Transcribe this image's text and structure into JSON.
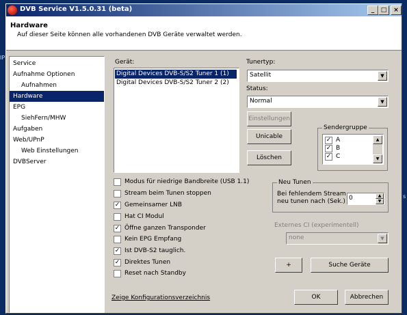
{
  "window": {
    "title": "DVB Service V1.5.0.31 (beta)",
    "controls": {
      "minimize": "_",
      "maximize": "□",
      "close": "×"
    }
  },
  "desktop": {
    "left_glyph": "IP",
    "right_glyph": "s"
  },
  "header": {
    "title": "Hardware",
    "description": "Auf dieser Seite können alle vorhandenen DVB Geräte verwaltet werden."
  },
  "nav": {
    "items": [
      {
        "label": "Service"
      },
      {
        "label": "Aufnahme Optionen"
      },
      {
        "label": "Aufnahmen"
      },
      {
        "label": "Hardware"
      },
      {
        "label": "EPG"
      },
      {
        "label": "SiehFern/MHW"
      },
      {
        "label": "Aufgaben"
      },
      {
        "label": "Web/UPnP"
      },
      {
        "label": "Web Einstellungen"
      },
      {
        "label": "DVBServer"
      }
    ]
  },
  "device": {
    "label": "Gerät:",
    "items": [
      "Digital Devices DVB-S/S2 Tuner 1 (1)",
      "Digital Devices DVB-S/S2 Tuner 2 (2)"
    ]
  },
  "tunertype": {
    "label": "Tunertyp:",
    "value": "Satellit"
  },
  "status": {
    "label": "Status:",
    "value": "Normal"
  },
  "buttons": {
    "settings": "Einstellungen",
    "unicable": "Unicable",
    "delete": "Löschen",
    "plus": "+",
    "search": "Suche Geräte",
    "ok": "OK",
    "cancel": "Abbrechen"
  },
  "sendergruppe": {
    "title": "Sendergruppe",
    "items": [
      {
        "label": "A",
        "checked": true
      },
      {
        "label": "B",
        "checked": true
      },
      {
        "label": "C",
        "checked": true
      }
    ]
  },
  "options": [
    {
      "label": "Modus für niedrige Bandbreite (USB 1.1)",
      "checked": false
    },
    {
      "label": "Stream beim Tunen stoppen",
      "checked": false
    },
    {
      "label": "Gemeinsamer LNB",
      "checked": true
    },
    {
      "label": "Hat CI Modul",
      "checked": false
    },
    {
      "label": "Öffne ganzen Transponder",
      "checked": true
    },
    {
      "label": "Kein EPG Empfang",
      "checked": false
    },
    {
      "label": "Ist DVB-S2 tauglich.",
      "checked": true
    },
    {
      "label": "Direktes Tunen",
      "checked": true
    },
    {
      "label": "Reset nach Standby",
      "checked": false
    }
  ],
  "neutunen": {
    "title": "Neu Tunen",
    "label_line1": "Bei fehlendem Stream",
    "label_line2": "neu tunen nach (Sek.)",
    "value": "0"
  },
  "externes_ci": {
    "label": "Externes CI (experimentell)",
    "value": "none"
  },
  "config_link": "Zeige Konfigurationsverzeichnis"
}
